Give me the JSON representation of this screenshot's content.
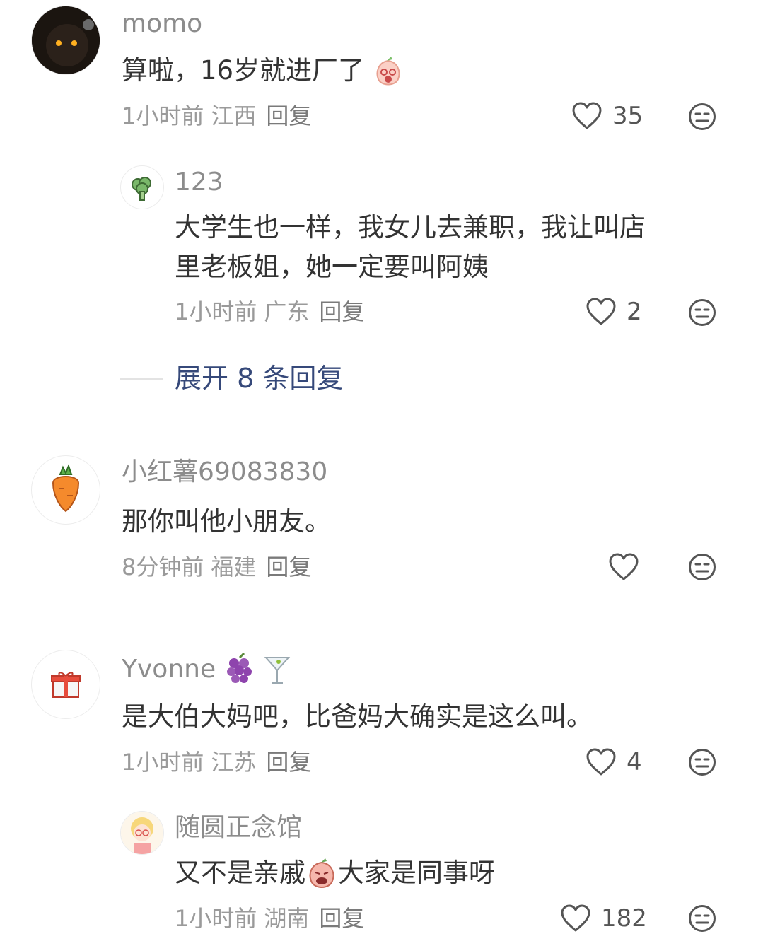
{
  "comments": [
    {
      "name": "momo",
      "text": "算啦，16岁就进厂了",
      "time": "1小时前",
      "location": "江西",
      "reply": "回复",
      "likes": "35",
      "replies": [
        {
          "name": "123",
          "text_line1": "大学生也一样，我女儿去兼职，我让叫店",
          "text_line2": "里老板姐，她一定要叫阿姨",
          "time": "1小时前",
          "location": "广东",
          "reply": "回复",
          "likes": "2"
        }
      ],
      "expand": "展开 8 条回复"
    },
    {
      "name": "小红薯69083830",
      "text": "那你叫他小朋友。",
      "time": "8分钟前",
      "location": "福建",
      "reply": "回复",
      "likes": ""
    },
    {
      "name": "Yvonne",
      "text": "是大伯大妈吧，比爸妈大确实是这么叫。",
      "time": "1小时前",
      "location": "江苏",
      "reply": "回复",
      "likes": "4",
      "replies": [
        {
          "name": "随圆正念馆",
          "text_a": "又不是亲戚",
          "text_b": "大家是同事呀",
          "time": "1小时前",
          "location": "湖南",
          "reply": "回复",
          "likes": "182"
        }
      ]
    }
  ],
  "icons": {
    "like": "heart-outline-icon",
    "dislike": "meh-face-icon"
  },
  "colors": {
    "text": "#333333",
    "meta": "#9a9a9a",
    "name": "#8c8c8c",
    "expand": "#36497a"
  }
}
